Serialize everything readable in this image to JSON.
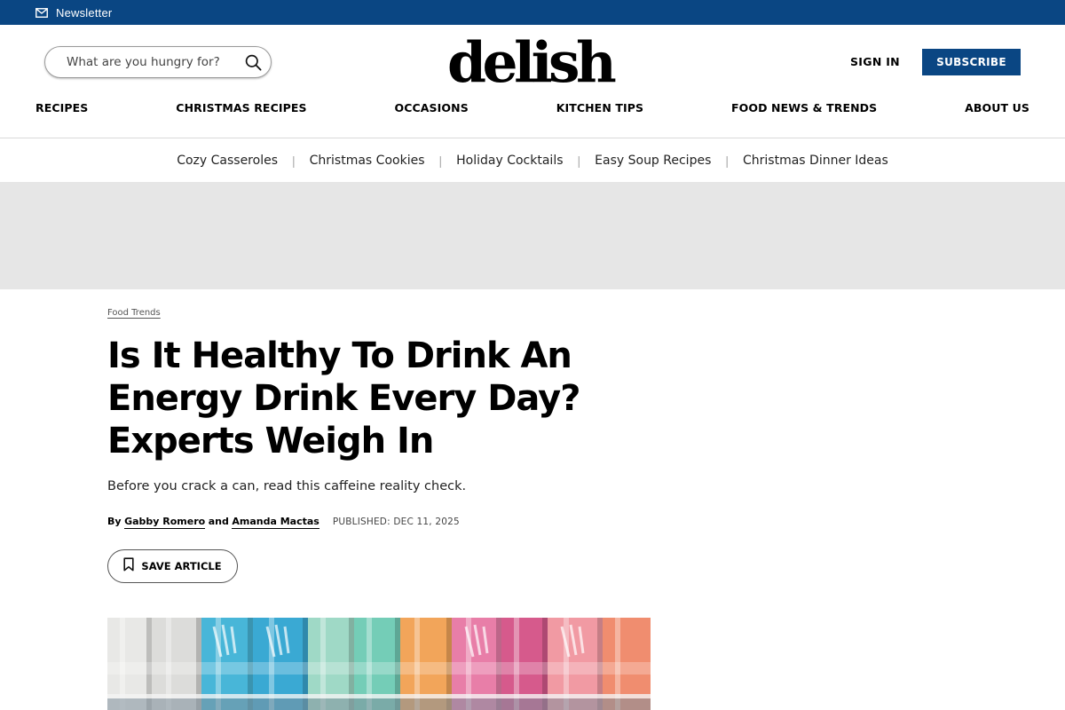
{
  "topbar": {
    "newsletter_label": "Newsletter",
    "bg_color": "#0a4683"
  },
  "header": {
    "search_placeholder": "What are you hungry for?",
    "logo_text": "delish",
    "sign_in_label": "SIGN IN",
    "subscribe_label": "SUBSCRIBE",
    "accent_color": "#0a4683"
  },
  "main_nav": [
    {
      "label": "RECIPES"
    },
    {
      "label": "CHRISTMAS RECIPES"
    },
    {
      "label": "OCCASIONS"
    },
    {
      "label": "KITCHEN TIPS"
    },
    {
      "label": "FOOD NEWS & TRENDS"
    },
    {
      "label": "ABOUT US"
    }
  ],
  "sub_nav": [
    {
      "label": "Cozy Casseroles"
    },
    {
      "label": "Christmas Cookies"
    },
    {
      "label": "Holiday Cocktails"
    },
    {
      "label": "Easy Soup Recipes"
    },
    {
      "label": "Christmas Dinner Ideas"
    }
  ],
  "sub_nav_separator": "|",
  "article": {
    "category": "Food Trends",
    "headline_lines": [
      "Is It Healthy To Drink An",
      "Energy Drink Every Day?",
      "Experts Weigh In"
    ],
    "dek": "Before you crack a can, read this caffeine reality check.",
    "byline": {
      "by": "By",
      "author_1": "Gabby Romero",
      "conjunction": "and",
      "author_2": "Amanda Mactas",
      "published": "PUBLISHED: DEC 11, 2025"
    },
    "save_label": "SAVE ARTICLE"
  },
  "icons": {
    "newsletter": "envelope-icon",
    "search": "search-icon",
    "save": "bookmark-icon"
  }
}
